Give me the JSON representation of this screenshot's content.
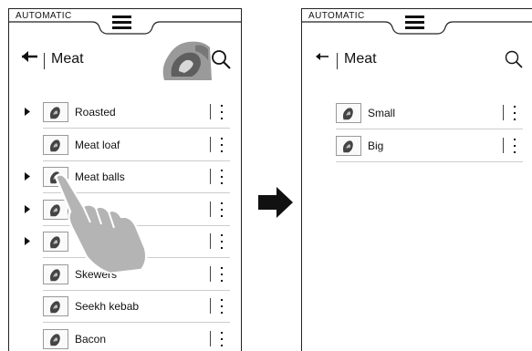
{
  "left_screen": {
    "mode_label": "AUTOMATIC",
    "title": "Meat",
    "icons": {
      "menu": "hamburger-icon",
      "back": "back-arrow-icon",
      "search": "search-icon",
      "more": "vertical-dots-icon",
      "expand": "triangle-right-icon"
    },
    "items": [
      {
        "label": "Roasted",
        "expandable": true
      },
      {
        "label": "Meat loaf",
        "expandable": false
      },
      {
        "label": "Meat balls",
        "expandable": true
      },
      {
        "label": "",
        "expandable": true
      },
      {
        "label": "",
        "expandable": true
      },
      {
        "label": "Skewers",
        "expandable": false
      },
      {
        "label": "Seekh kebab",
        "expandable": false
      },
      {
        "label": "Bacon",
        "expandable": false
      }
    ]
  },
  "right_screen": {
    "mode_label": "AUTOMATIC",
    "title": "Meat",
    "items": [
      {
        "label": "Small",
        "expandable": false
      },
      {
        "label": "Big",
        "expandable": false
      }
    ]
  },
  "colors": {
    "border": "#222222",
    "text": "#111111",
    "hand": "#b4b4b4",
    "separator": "#cccccc"
  }
}
